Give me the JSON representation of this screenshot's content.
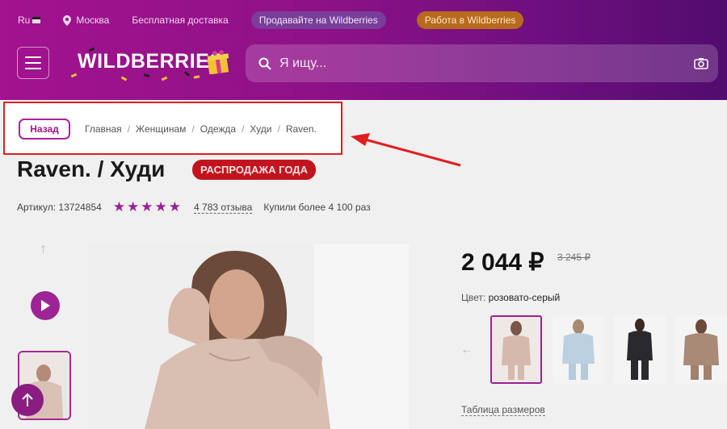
{
  "header": {
    "locale": "Ru",
    "city": "Москва",
    "delivery": "Бесплатная доставка",
    "sell_label": "Продавайте на Wildberries",
    "work_label": "Работа в Wildberries",
    "logo_text": "WILDBERRIES",
    "search_placeholder": "Я ищу..."
  },
  "breadcrumb": {
    "back_label": "Назад",
    "items": [
      "Главная",
      "Женщинам",
      "Одежда",
      "Худи",
      "Raven."
    ],
    "separator": "/"
  },
  "product": {
    "title": "Raven. / Худи",
    "badge": "РАСПРОДАЖА ГОДА",
    "article_label": "Артикул:",
    "article": "13724854",
    "rating_stars": 5,
    "stars_text": "★★★★★",
    "reviews": "4 783 отзыва",
    "bought": "Купили более 4 100 раз",
    "price": "2 044 ₽",
    "old_price": "3 245 ₽",
    "color_label": "Цвет:",
    "color_value": "розовато-серый",
    "size_table": "Таблица размеров"
  },
  "colors": {
    "brand": "#a3128f",
    "badge": "#c2141e",
    "highlight": "#e01e1e"
  },
  "icons": {
    "location": "location-pin-icon",
    "search": "search-icon",
    "camera": "camera-icon",
    "menu": "menu-icon",
    "play": "play-icon",
    "scroll_top": "arrow-up-icon"
  }
}
